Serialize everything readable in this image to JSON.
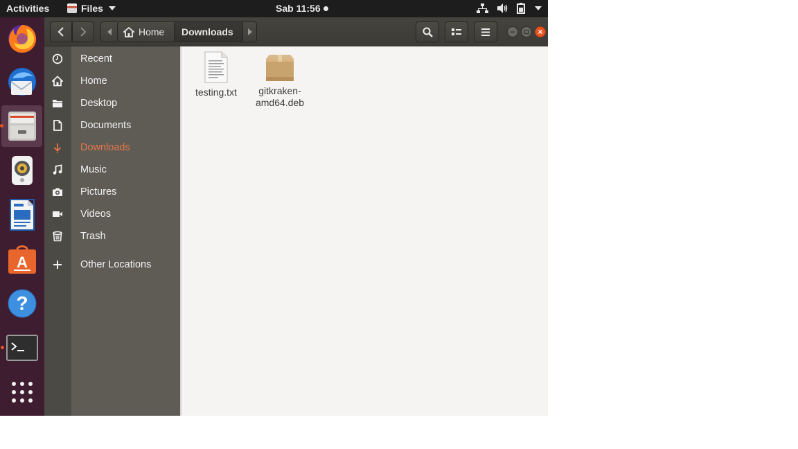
{
  "topbar": {
    "activities": "Activities",
    "app_menu": "Files",
    "clock": "Sab 11:56"
  },
  "dock": {
    "items": [
      {
        "name": "Firefox",
        "icon": "firefox-icon"
      },
      {
        "name": "Thunderbird",
        "icon": "thunderbird-icon"
      },
      {
        "name": "Files",
        "icon": "files-icon",
        "active": true
      },
      {
        "name": "Rhythmbox",
        "icon": "rhythmbox-icon"
      },
      {
        "name": "LibreOffice Writer",
        "icon": "writer-icon"
      },
      {
        "name": "Ubuntu Software",
        "icon": "software-icon"
      },
      {
        "name": "Help",
        "icon": "help-icon"
      },
      {
        "name": "Terminal",
        "icon": "terminal-icon"
      },
      {
        "name": "Show Applications",
        "icon": "apps-grid-icon"
      }
    ]
  },
  "breadcrumb": {
    "home": "Home",
    "current": "Downloads"
  },
  "sidebar": {
    "items": [
      {
        "label": "Recent",
        "icon": "clock-icon"
      },
      {
        "label": "Home",
        "icon": "home-icon"
      },
      {
        "label": "Desktop",
        "icon": "folder-icon"
      },
      {
        "label": "Documents",
        "icon": "document-icon"
      },
      {
        "label": "Downloads",
        "icon": "download-icon",
        "active": true
      },
      {
        "label": "Music",
        "icon": "music-icon"
      },
      {
        "label": "Pictures",
        "icon": "camera-icon"
      },
      {
        "label": "Videos",
        "icon": "video-icon"
      },
      {
        "label": "Trash",
        "icon": "trash-icon"
      },
      {
        "label": "Other Locations",
        "icon": "plus-icon"
      }
    ]
  },
  "files": [
    {
      "name_line1": "testing.txt",
      "name_line2": "",
      "icon": "text-file-icon"
    },
    {
      "name_line1": "gitkraken-",
      "name_line2": "amd64.deb",
      "icon": "package-icon"
    }
  ],
  "colors": {
    "accent": "#e95420",
    "active_label": "#e9774a",
    "dock_bg": "#3f1d30",
    "sidebar_bg": "#5e5c55",
    "content_bg": "#f5f4f2"
  }
}
